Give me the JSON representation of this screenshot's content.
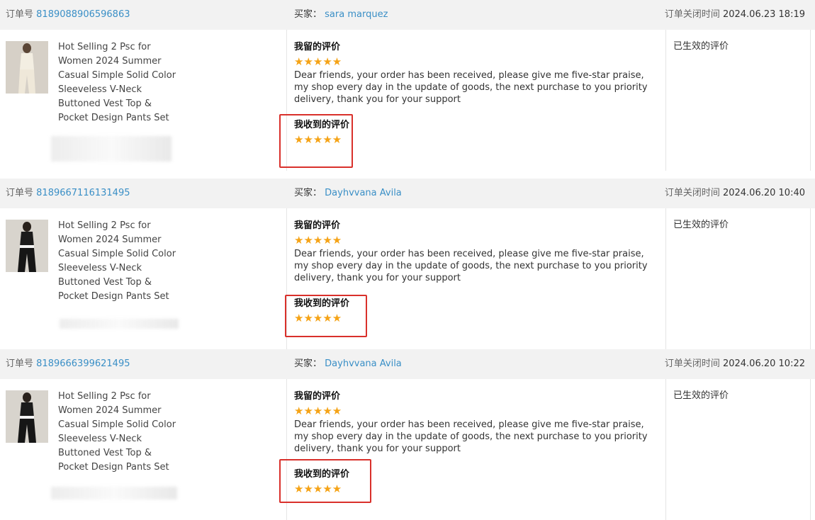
{
  "orders": [
    {
      "order_label": "订单号",
      "order_id": "8189088906596863",
      "buyer_label": "买家：",
      "buyer_name": "sara marquez",
      "closed_label": "订单关闭时间",
      "closed_time": "2024.06.23 18:19",
      "product_title": "Hot Selling 2 Psc for\nWomen 2024 Summer\nCasual Simple Solid Color\nSleeveless V-Neck\nButtoned Vest Top &\nPocket Design Pants Set",
      "my_review_heading": "我留的评价",
      "my_review_stars": "★★★★★",
      "my_review_text": "Dear friends, your order has been received, please give me five-star praise, my shop every day in the update of goods, the next purchase to you priority delivery, thank you for your support",
      "received_review_heading": "我收到的评价",
      "received_review_stars": "★★★★★",
      "status": "已生效的评价",
      "product_color": "light"
    },
    {
      "order_label": "订单号",
      "order_id": "8189667116131495",
      "buyer_label": "买家：",
      "buyer_name": "Dayhvvana Avila",
      "closed_label": "订单关闭时间",
      "closed_time": "2024.06.20 10:40",
      "product_title": "Hot Selling 2 Psc for\nWomen 2024 Summer\nCasual Simple Solid Color\nSleeveless V-Neck\nButtoned Vest Top &\nPocket Design Pants Set",
      "my_review_heading": "我留的评价",
      "my_review_stars": "★★★★★",
      "my_review_text": "Dear friends, your order has been received, please give me five-star praise, my shop every day in the update of goods, the next purchase to you priority delivery, thank you for your support",
      "received_review_heading": "我收到的评价",
      "received_review_stars": "★★★★★",
      "status": "已生效的评价",
      "product_color": "dark"
    },
    {
      "order_label": "订单号",
      "order_id": "8189666399621495",
      "buyer_label": "买家：",
      "buyer_name": "Dayhvvana Avila",
      "closed_label": "订单关闭时间",
      "closed_time": "2024.06.20 10:22",
      "product_title": "Hot Selling 2 Psc for\nWomen 2024 Summer\nCasual Simple Solid Color\nSleeveless V-Neck\nButtoned Vest Top &\nPocket Design Pants Set",
      "my_review_heading": "我留的评价",
      "my_review_stars": "★★★★★",
      "my_review_text": "Dear friends, your order has been received, please give me five-star praise, my shop every day in the update of goods, the next purchase to you priority delivery, thank you for your support",
      "received_review_heading": "我收到的评价",
      "received_review_stars": "★★★★★",
      "status": "已生效的评价",
      "product_color": "dark"
    }
  ],
  "colors": {
    "link": "#3a8fc6",
    "star": "#f5a316",
    "highlight_border": "#d9302b",
    "header_bg": "#f2f2f2"
  }
}
